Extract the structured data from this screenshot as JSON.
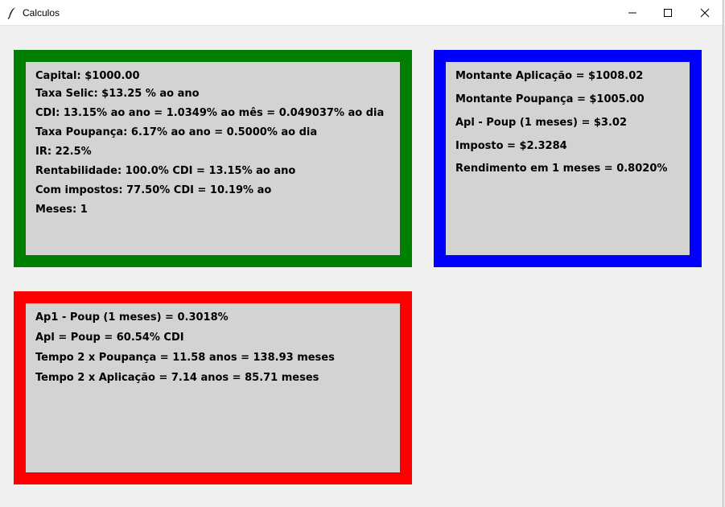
{
  "window": {
    "title": "Calculos"
  },
  "title_controls": {
    "minimize_icon": "minimize-icon",
    "maximize_icon": "maximize-icon",
    "close_icon": "close-icon"
  },
  "panels": {
    "inputs": {
      "border_color": "#008000",
      "lines": [
        "Capital: $1000.00",
        "Taxa Selic: $13.25 % ao ano",
        "CDI: 13.15% ao ano = 1.0349% ao mês = 0.049037% ao dia",
        "Taxa Poupança: 6.17% ao ano = 0.5000% ao dia",
        "IR: 22.5%",
        "Rentabilidade: 100.0% CDI = 13.15% ao ano",
        "Com impostos: 77.50% CDI = 10.19% ao",
        "Meses: 1"
      ]
    },
    "results": {
      "border_color": "#0000ff",
      "lines": [
        "Montante Aplicação = $1008.02",
        "Montante Poupança = $1005.00",
        "Apl - Poup (1 meses) = $3.02",
        "Imposto = $2.3284",
        "Rendimento em 1 meses = 0.8020%"
      ]
    },
    "comparison": {
      "border_color": "#ff0000",
      "lines": [
        "Ap1 - Poup (1 meses) = 0.3018%",
        "Apl = Poup = 60.54% CDI",
        "Tempo 2 x Poupança = 11.58 anos = 138.93 meses",
        "Tempo 2 x Aplicação = 7.14 anos = 85.71 meses"
      ]
    }
  }
}
